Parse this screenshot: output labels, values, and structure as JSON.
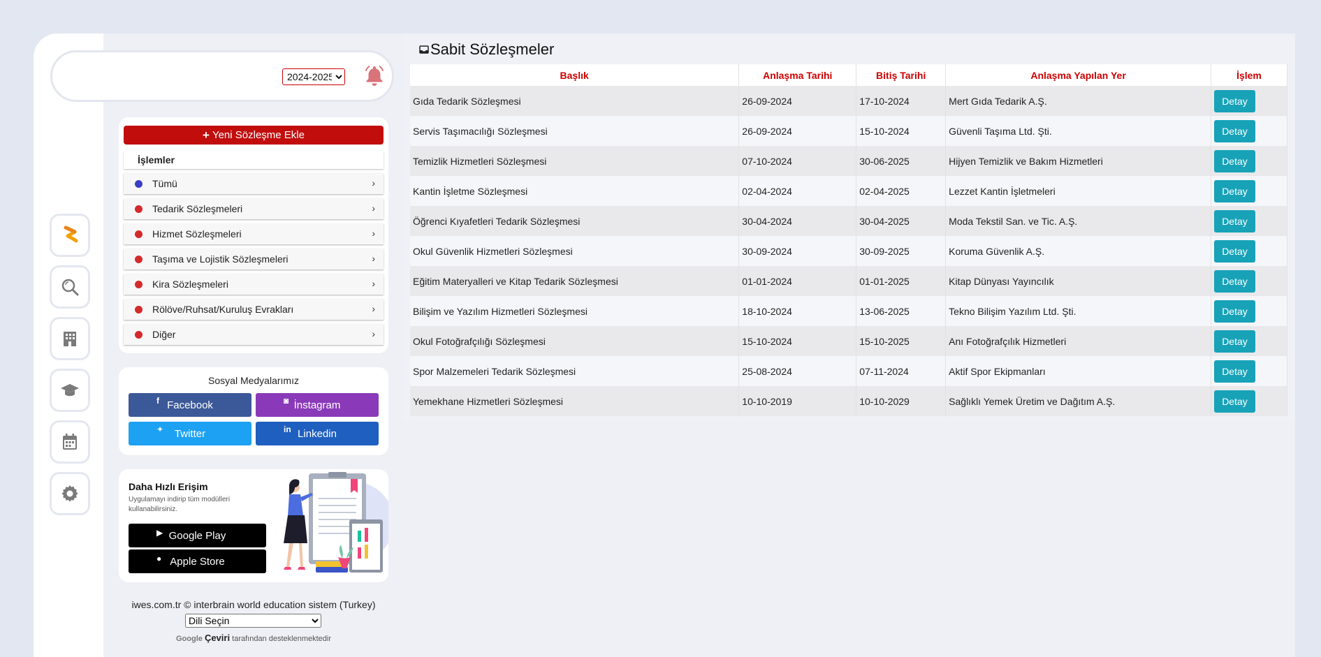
{
  "header": {
    "year_selected": "2024-2025",
    "year_options": [
      "2024-2025"
    ]
  },
  "rail": {
    "icons": [
      "logo-icon",
      "search-icon",
      "building-icon",
      "graduation-cap-icon",
      "calendar-icon",
      "gear-icon"
    ]
  },
  "menu": {
    "add_label": "Yeni Sözleşme Ekle",
    "header": "İşlemler",
    "items": [
      {
        "label": "Tümü",
        "color": "#3b3fc4"
      },
      {
        "label": "Tedarik Sözleşmeleri",
        "color": "#d42a2a"
      },
      {
        "label": "Hizmet Sözleşmeleri",
        "color": "#d42a2a"
      },
      {
        "label": "Taşıma ve Lojistik Sözleşmeleri",
        "color": "#d42a2a"
      },
      {
        "label": "Kira Sözleşmeleri",
        "color": "#d42a2a"
      },
      {
        "label": "Rölöve/Ruhsat/Kuruluş Evrakları",
        "color": "#d42a2a"
      },
      {
        "label": "Diğer",
        "color": "#d42a2a"
      }
    ]
  },
  "social": {
    "title": "Sosyal Medyalarımız",
    "facebook": "Facebook",
    "instagram": "İnstagram",
    "twitter": "Twitter",
    "linkedin": "Linkedin",
    "colors": {
      "facebook": "#3b5998",
      "instagram": "#8a3ab9",
      "twitter": "#1da1f2",
      "linkedin": "#1f5fbf"
    }
  },
  "app": {
    "title": "Daha Hızlı Erişim",
    "subtitle": "Uygulamayı indirip tüm modülleri kullanabilirsiniz.",
    "google_play": "Google Play",
    "apple_store": "Apple Store"
  },
  "footer": {
    "copyright": "iwes.com.tr © interbrain world education sistem (Turkey)",
    "language_select": "Dili Seçin",
    "powered_google": "Google",
    "powered_ceviri": "Çeviri",
    "powered_text": "tarafından desteklenmektedir"
  },
  "main": {
    "title": "Sabit Sözleşmeler",
    "columns": [
      "Başlık",
      "Anlaşma Tarihi",
      "Bitiş Tarihi",
      "Anlaşma Yapılan Yer",
      "İşlem"
    ],
    "detail_label": "Detay",
    "rows": [
      [
        "Gıda Tedarik Sözleşmesi",
        "26-09-2024",
        "17-10-2024",
        "Mert Gıda Tedarik A.Ş."
      ],
      [
        "Servis Taşımacılığı Sözleşmesi",
        "26-09-2024",
        "15-10-2024",
        "Güvenli Taşıma Ltd. Şti."
      ],
      [
        "Temizlik Hizmetleri Sözleşmesi",
        "07-10-2024",
        "30-06-2025",
        "Hijyen Temizlik ve Bakım Hizmetleri"
      ],
      [
        "Kantin İşletme Sözleşmesi",
        "02-04-2024",
        "02-04-2025",
        "Lezzet Kantin İşletmeleri"
      ],
      [
        "Öğrenci Kıyafetleri Tedarik Sözleşmesi",
        "30-04-2024",
        "30-04-2025",
        "Moda Tekstil San. ve Tic. A.Ş."
      ],
      [
        "Okul Güvenlik Hizmetleri Sözleşmesi",
        "30-09-2024",
        "30-09-2025",
        "Koruma Güvenlik A.Ş."
      ],
      [
        "Eğitim Materyalleri ve Kitap Tedarik Sözleşmesi",
        "01-01-2024",
        "01-01-2025",
        "Kitap Dünyası Yayıncılık"
      ],
      [
        "Bilişim ve Yazılım Hizmetleri Sözleşmesi",
        "18-10-2024",
        "13-06-2025",
        "Tekno Bilişim Yazılım Ltd. Şti."
      ],
      [
        "Okul Fotoğrafçılığı Sözleşmesi",
        "15-10-2024",
        "15-10-2025",
        "Anı Fotoğrafçılık Hizmetleri"
      ],
      [
        "Spor Malzemeleri Tedarik Sözleşmesi",
        "25-08-2024",
        "07-11-2024",
        "Aktif Spor Ekipmanları"
      ],
      [
        "Yemekhane Hizmetleri Sözleşmesi",
        "10-10-2019",
        "10-10-2029",
        "Sağlıklı Yemek Üretim ve Dağıtım A.Ş."
      ]
    ]
  },
  "accent": {
    "primary_red": "#c20d0d",
    "detail_teal": "#17a2b8"
  }
}
